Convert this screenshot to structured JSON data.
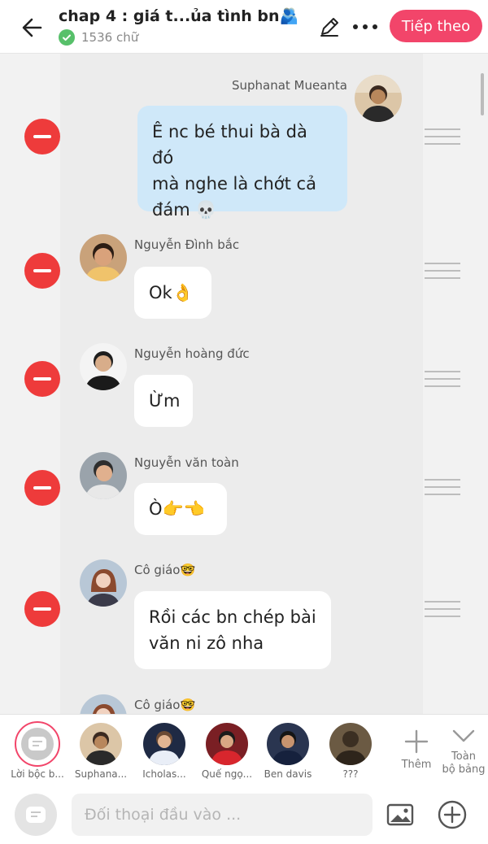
{
  "header": {
    "title": "chap 4 : giá t...ủa tình bn🫂",
    "word_count": "1536 chữ",
    "next_label": "Tiếp theo"
  },
  "messages": [
    {
      "sender": "Suphanat Mueanta",
      "side": "right",
      "text": "Ê nc bé thui bà dà đó\nmà nghe là chớt cả\nđám 💀"
    },
    {
      "sender": "Nguyễn Đình bắc",
      "side": "left",
      "text": "Ok👌"
    },
    {
      "sender": "Nguyễn hoàng đức",
      "side": "left",
      "text": "Ừm"
    },
    {
      "sender": "Nguyễn văn toàn",
      "side": "left",
      "text": "Ò👉👈"
    },
    {
      "sender": "Cô giáo🤓",
      "side": "left",
      "text": "Rồi các bn chép bài\nvăn ni zô nha"
    },
    {
      "sender": "Cô giáo🤓",
      "side": "left",
      "text": ""
    }
  ],
  "characters": [
    {
      "label": "Lời bộc b...",
      "icon": "narrator-icon",
      "selected": true
    },
    {
      "label": "Suphana..."
    },
    {
      "label": "Icholas..."
    },
    {
      "label": "Quế ngọ..."
    },
    {
      "label": "Ben davis"
    },
    {
      "label": "???"
    }
  ],
  "strip": {
    "add_label": "Thêm",
    "collapse_label": "Toàn\nbộ bảng"
  },
  "input": {
    "placeholder": "Đối thoại đầu vào ..."
  },
  "colors": {
    "accent": "#f2456a",
    "delete": "#ee3b3b",
    "my_bubble": "#cfe8f9",
    "check": "#57c06a"
  }
}
